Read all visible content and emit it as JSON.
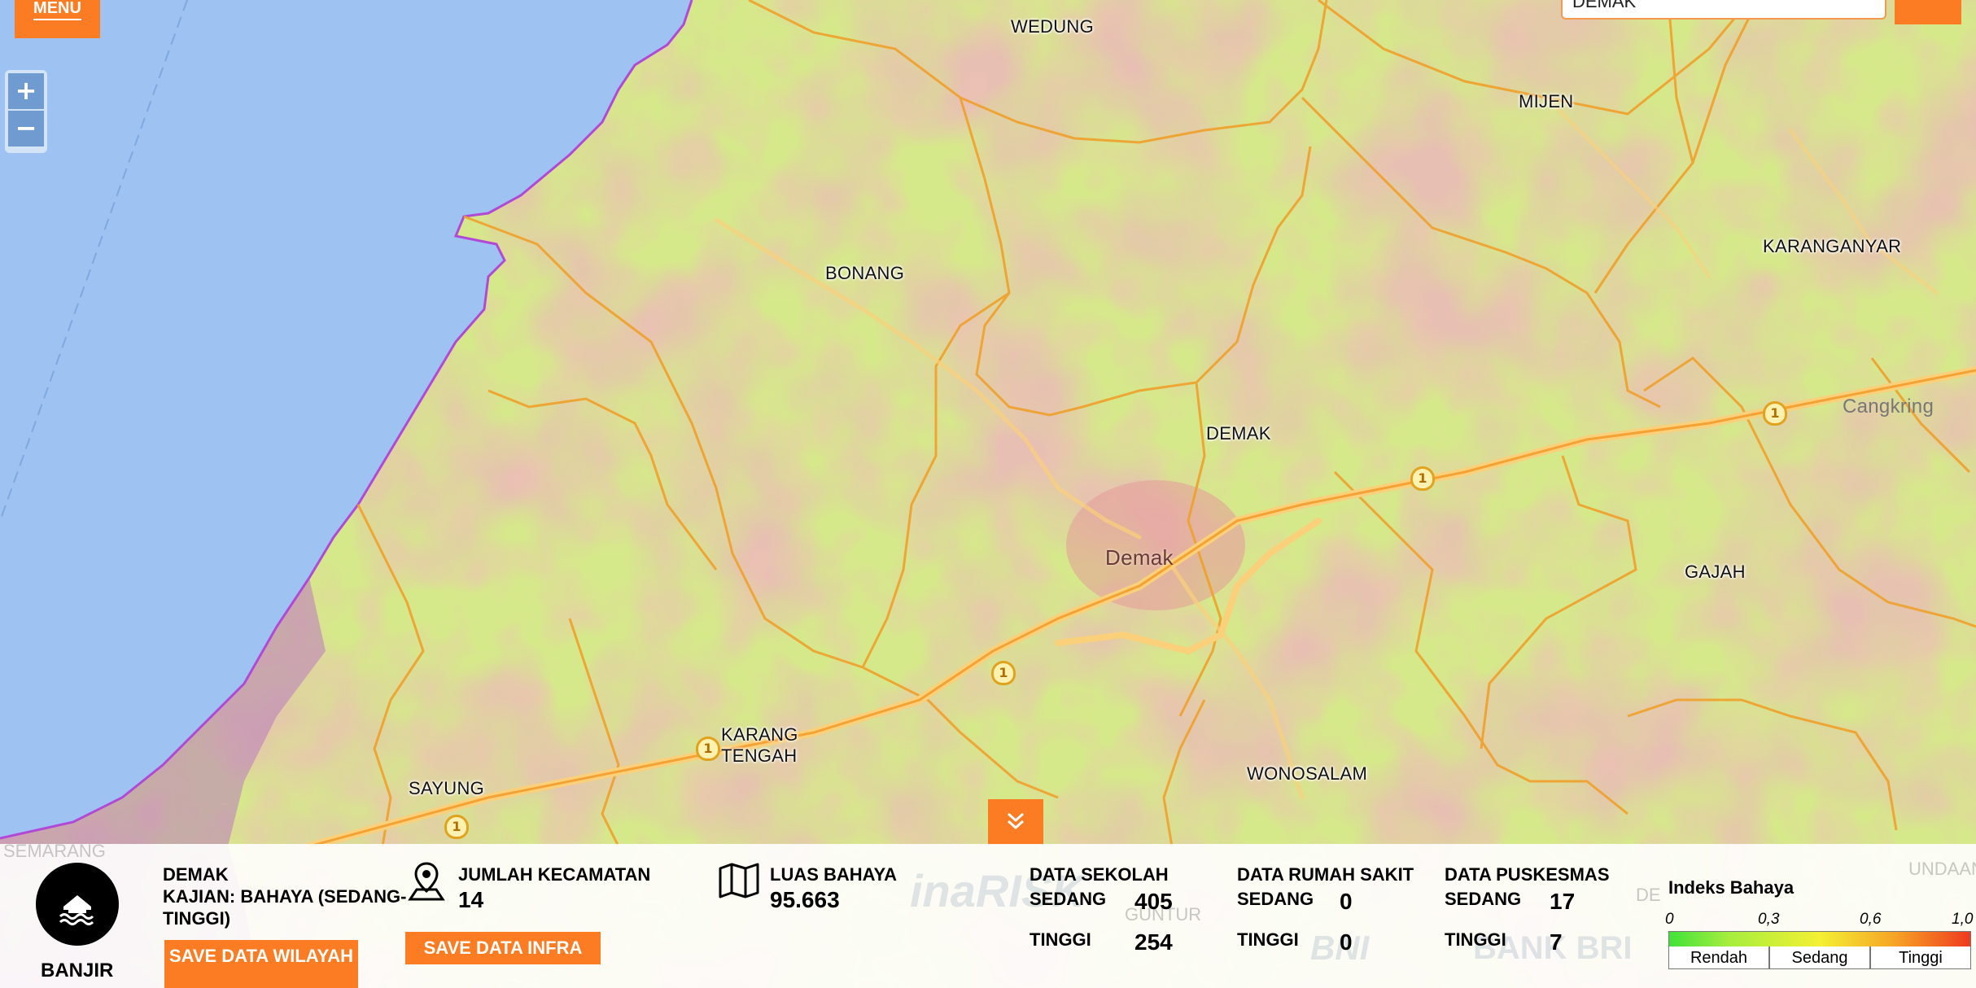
{
  "header": {
    "menu_label": "MENU",
    "search_value": "DEMAK",
    "zoom_in": "+",
    "zoom_out": "−",
    "collapse_icon": "⌄⌄"
  },
  "map": {
    "labels": {
      "wedung": "WEDUNG",
      "mijen": "MIJEN",
      "karanganyar": "KARANGANYAR",
      "bonang": "BONANG",
      "demak_district": "DEMAK",
      "demak_town": "Demak",
      "cangkring": "Cangkring",
      "gajah": "GAJAH",
      "karang_tengah": "KARANG\nTENGAH",
      "sayung": "SAYUNG",
      "wonosalam": "WONOSALAM",
      "semarang": "SEMARANG"
    },
    "route_number": "1"
  },
  "panel": {
    "hazard_name": "BANJIR",
    "hazard_icon": "flood-house-icon",
    "region": "DEMAK",
    "kajian": "KAJIAN: BAHAYA (SEDANG-TINGGI)",
    "save_wilayah": "SAVE DATA WILAYAH",
    "save_infra": "SAVE DATA INFRA",
    "kecamatan_label": "JUMLAH KECAMATAN",
    "kecamatan_value": "14",
    "luas_label": "LUAS BAHAYA",
    "luas_value": "95.663",
    "sekolah": {
      "title": "DATA SEKOLAH",
      "sedang_label": "SEDANG",
      "sedang": "405",
      "tinggi_label": "TINGGI",
      "tinggi": "254"
    },
    "rumah_sakit": {
      "title": "DATA RUMAH SAKIT",
      "sedang_label": "SEDANG",
      "sedang": "0",
      "tinggi_label": "TINGGI",
      "tinggi": "0"
    },
    "puskesmas": {
      "title": "DATA PUSKESMAS",
      "sedang_label": "SEDANG",
      "sedang": "17",
      "tinggi_label": "TINGGI",
      "tinggi": "7"
    }
  },
  "legend": {
    "title": "Indeks Bahaya",
    "ticks": [
      "0",
      "0,3",
      "0,6",
      "1,0"
    ],
    "classes": [
      "Rendah",
      "Sedang",
      "Tinggi"
    ],
    "colors": [
      "#40e23a",
      "#f4f033",
      "#ef3a1e"
    ]
  },
  "background": {
    "watermark": "inaRISK",
    "bank": "BANK BRI",
    "bni": "BNI",
    "side_a": "UNDAAN",
    "side_b": "DE",
    "side_c": "GUNTUR"
  }
}
